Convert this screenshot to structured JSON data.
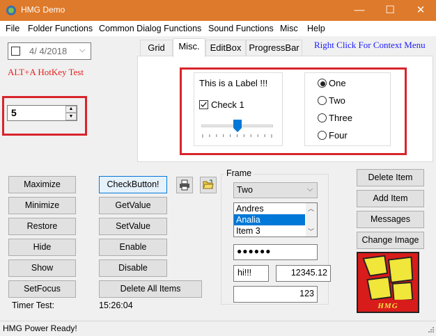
{
  "window": {
    "title": "HMG Demo",
    "minimize": "—",
    "maximize": "☐",
    "close": "✕"
  },
  "menu": [
    "File",
    "Folder Functions",
    "Common Dialog Functions",
    "Sound Functions",
    "Misc",
    "Help"
  ],
  "date_picker": {
    "value": "4/  4/2018",
    "checked": false
  },
  "hotkey_label": "ALT+A HotKey Test",
  "spinner": {
    "value": "5"
  },
  "tabs": [
    "Grid",
    "Misc.",
    "EditBox",
    "ProgressBar"
  ],
  "active_tab": "Misc.",
  "context_menu_hint": "Right Click For Context Menu",
  "misc_tab": {
    "label": "This is a Label !!!",
    "checkbox": {
      "label": "Check 1",
      "checked": true
    },
    "slider": {
      "value": 5,
      "min": 0,
      "max": 10
    },
    "radios": [
      "One",
      "Two",
      "Three",
      "Four"
    ],
    "radio_selected": "One"
  },
  "left_buttons": [
    "Maximize",
    "Minimize",
    "Restore",
    "Hide",
    "Show",
    "SetFocus"
  ],
  "mid_buttons": [
    "CheckButton!",
    "GetValue",
    "SetValue",
    "Enable",
    "Disable",
    "Delete All Items"
  ],
  "timer": {
    "label": "Timer Test:",
    "value": "15:26:04"
  },
  "frame": {
    "title": "Frame",
    "combo_value": "Two",
    "list_items": [
      "Andres",
      "Analia",
      "Item 3"
    ],
    "list_selected": "Analia",
    "password": "●●●●●●",
    "text": "hi!!!",
    "number": "12345.12",
    "integer": "123"
  },
  "right_buttons": [
    "Delete Item",
    "Add Item",
    "Messages",
    "Change Image"
  ],
  "logo_text": "HMG",
  "status": "HMG Power Ready!",
  "colors": {
    "titlebar": "#de7a2b",
    "highlight_box": "#d8242b",
    "link_blue": "#1a1aff",
    "hotkey_red": "#e0201c"
  }
}
